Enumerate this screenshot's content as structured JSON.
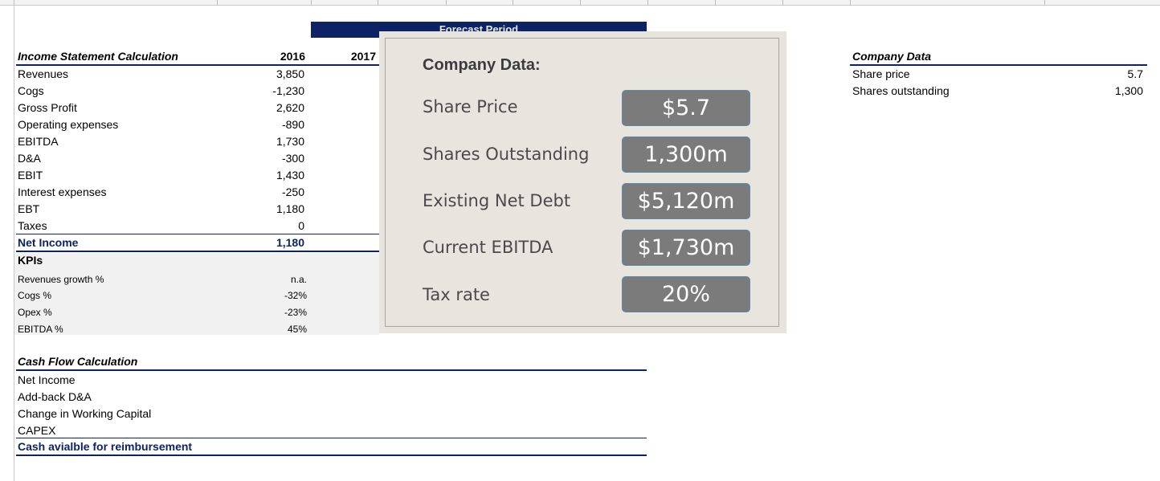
{
  "forecast_label": "Forecast Period",
  "income": {
    "title": "Income Statement Calculation",
    "year1": "2016",
    "year2": "2017",
    "rows": [
      {
        "label": "Revenues",
        "v": "3,850"
      },
      {
        "label": "Cogs",
        "v": "-1,230"
      },
      {
        "label": "Gross Profit",
        "v": "2,620"
      },
      {
        "label": "Operating expenses",
        "v": "-890"
      },
      {
        "label": "EBITDA",
        "v": "1,730"
      },
      {
        "label": "D&A",
        "v": "-300"
      },
      {
        "label": "EBIT",
        "v": "1,430"
      },
      {
        "label": "Interest expenses",
        "v": "-250"
      },
      {
        "label": "EBT",
        "v": "1,180"
      },
      {
        "label": "Taxes",
        "v": "0"
      }
    ],
    "net_income_label": "Net Income",
    "net_income_value": "1,180"
  },
  "kpis": {
    "title": "KPIs",
    "rows": [
      {
        "label": "Revenues growth %",
        "v": "n.a."
      },
      {
        "label": "Cogs %",
        "v": "-32%"
      },
      {
        "label": "Opex %",
        "v": "-23%"
      },
      {
        "label": "EBITDA %",
        "v": "45%"
      }
    ]
  },
  "cashflow": {
    "title": "Cash Flow Calculation",
    "rows": [
      "Net Income",
      "Add-back D&A",
      "Change in Working Capital",
      "CAPEX"
    ],
    "total": "Cash avialble for reimbursement"
  },
  "company": {
    "title": "Company Data",
    "rows": [
      {
        "label": "Share price",
        "v": "5.7"
      },
      {
        "label": "Shares outstanding",
        "v": "1,300"
      }
    ]
  },
  "overlay": {
    "title": "Company Data:",
    "items": [
      {
        "label": "Share Price",
        "value": "$5.7"
      },
      {
        "label": "Shares Outstanding",
        "value": "1,300m"
      },
      {
        "label": "Existing Net Debt",
        "value": "$5,120m"
      },
      {
        "label": "Current EBITDA",
        "value": "$1,730m"
      },
      {
        "label": "Tax rate",
        "value": "20%"
      }
    ]
  }
}
